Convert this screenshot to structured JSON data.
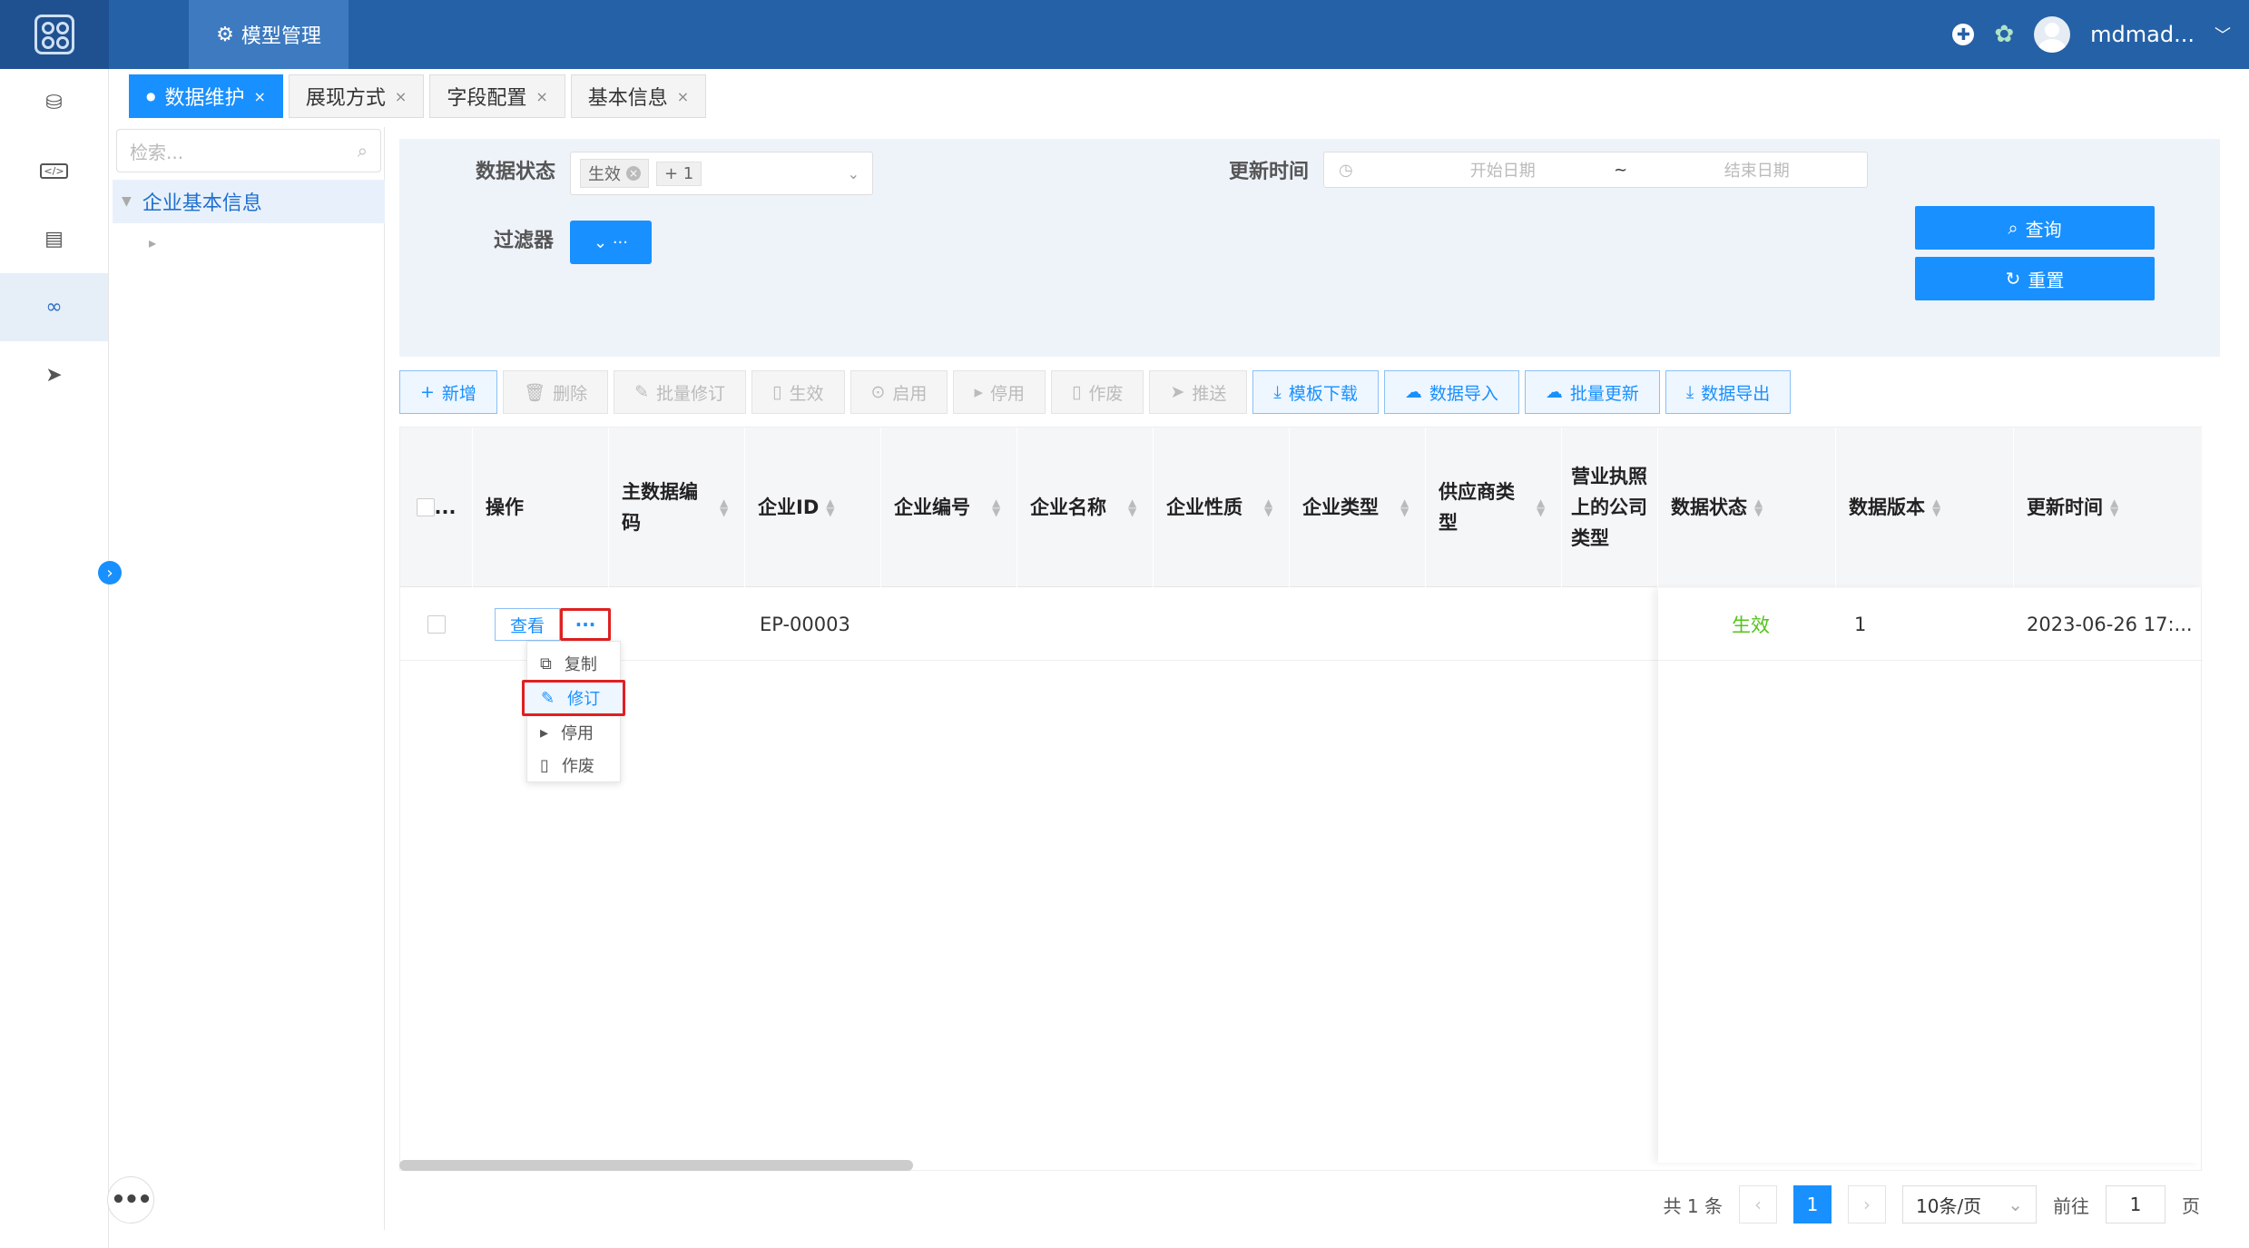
{
  "app": {
    "top_tab_label": "模型管理",
    "username": "mdmad..."
  },
  "tabs": [
    {
      "label": "数据维护",
      "active": true
    },
    {
      "label": "展现方式"
    },
    {
      "label": "字段配置"
    },
    {
      "label": "基本信息"
    }
  ],
  "tree": {
    "search_placeholder": "检索...",
    "root_label": "企业基本信息"
  },
  "filter": {
    "status_label": "数据状态",
    "status_chip": "生效",
    "status_more": "+ 1",
    "time_label": "更新时间",
    "start_placeholder": "开始日期",
    "separator": "~",
    "end_placeholder": "结束日期",
    "filter_label": "过滤器",
    "query_label": "查询",
    "reset_label": "重置"
  },
  "toolbar": {
    "add": "新增",
    "delete": "删除",
    "batch_revise": "批量修订",
    "effect": "生效",
    "enable": "启用",
    "disable": "停用",
    "void": "作废",
    "push": "推送",
    "template_download": "模板下载",
    "data_import": "数据导入",
    "batch_update": "批量更新",
    "data_export": "数据导出"
  },
  "table": {
    "headers": {
      "select": "...",
      "action": "操作",
      "master_code": "主数据编码",
      "enterprise_id": "企业ID",
      "enterprise_no": "企业编号",
      "enterprise_name": "企业名称",
      "enterprise_nature": "企业性质",
      "enterprise_type": "企业类型",
      "supplier_type": "供应商类型",
      "license_company_type": "营业执照上的公司类型",
      "data_status": "数据状态",
      "data_version": "数据版本",
      "update_time": "更新时间"
    },
    "rows": [
      {
        "view_label": "查看",
        "more_label": "···",
        "enterprise_id": "EP-00003",
        "status": "生效",
        "version": "1",
        "update_time": "2023-06-26 17:..."
      }
    ]
  },
  "row_menu": {
    "copy": "复制",
    "revise": "修订",
    "disable": "停用",
    "void": "作废"
  },
  "pager": {
    "total": "共 1 条",
    "current_page": "1",
    "page_size": "10条/页",
    "goto_label": "前往",
    "goto_value": "1",
    "page_suffix": "页"
  },
  "colors": {
    "primary": "#1890ff",
    "header": "#2561a6",
    "highlight": "#e02020",
    "status_green": "#52c41a"
  }
}
